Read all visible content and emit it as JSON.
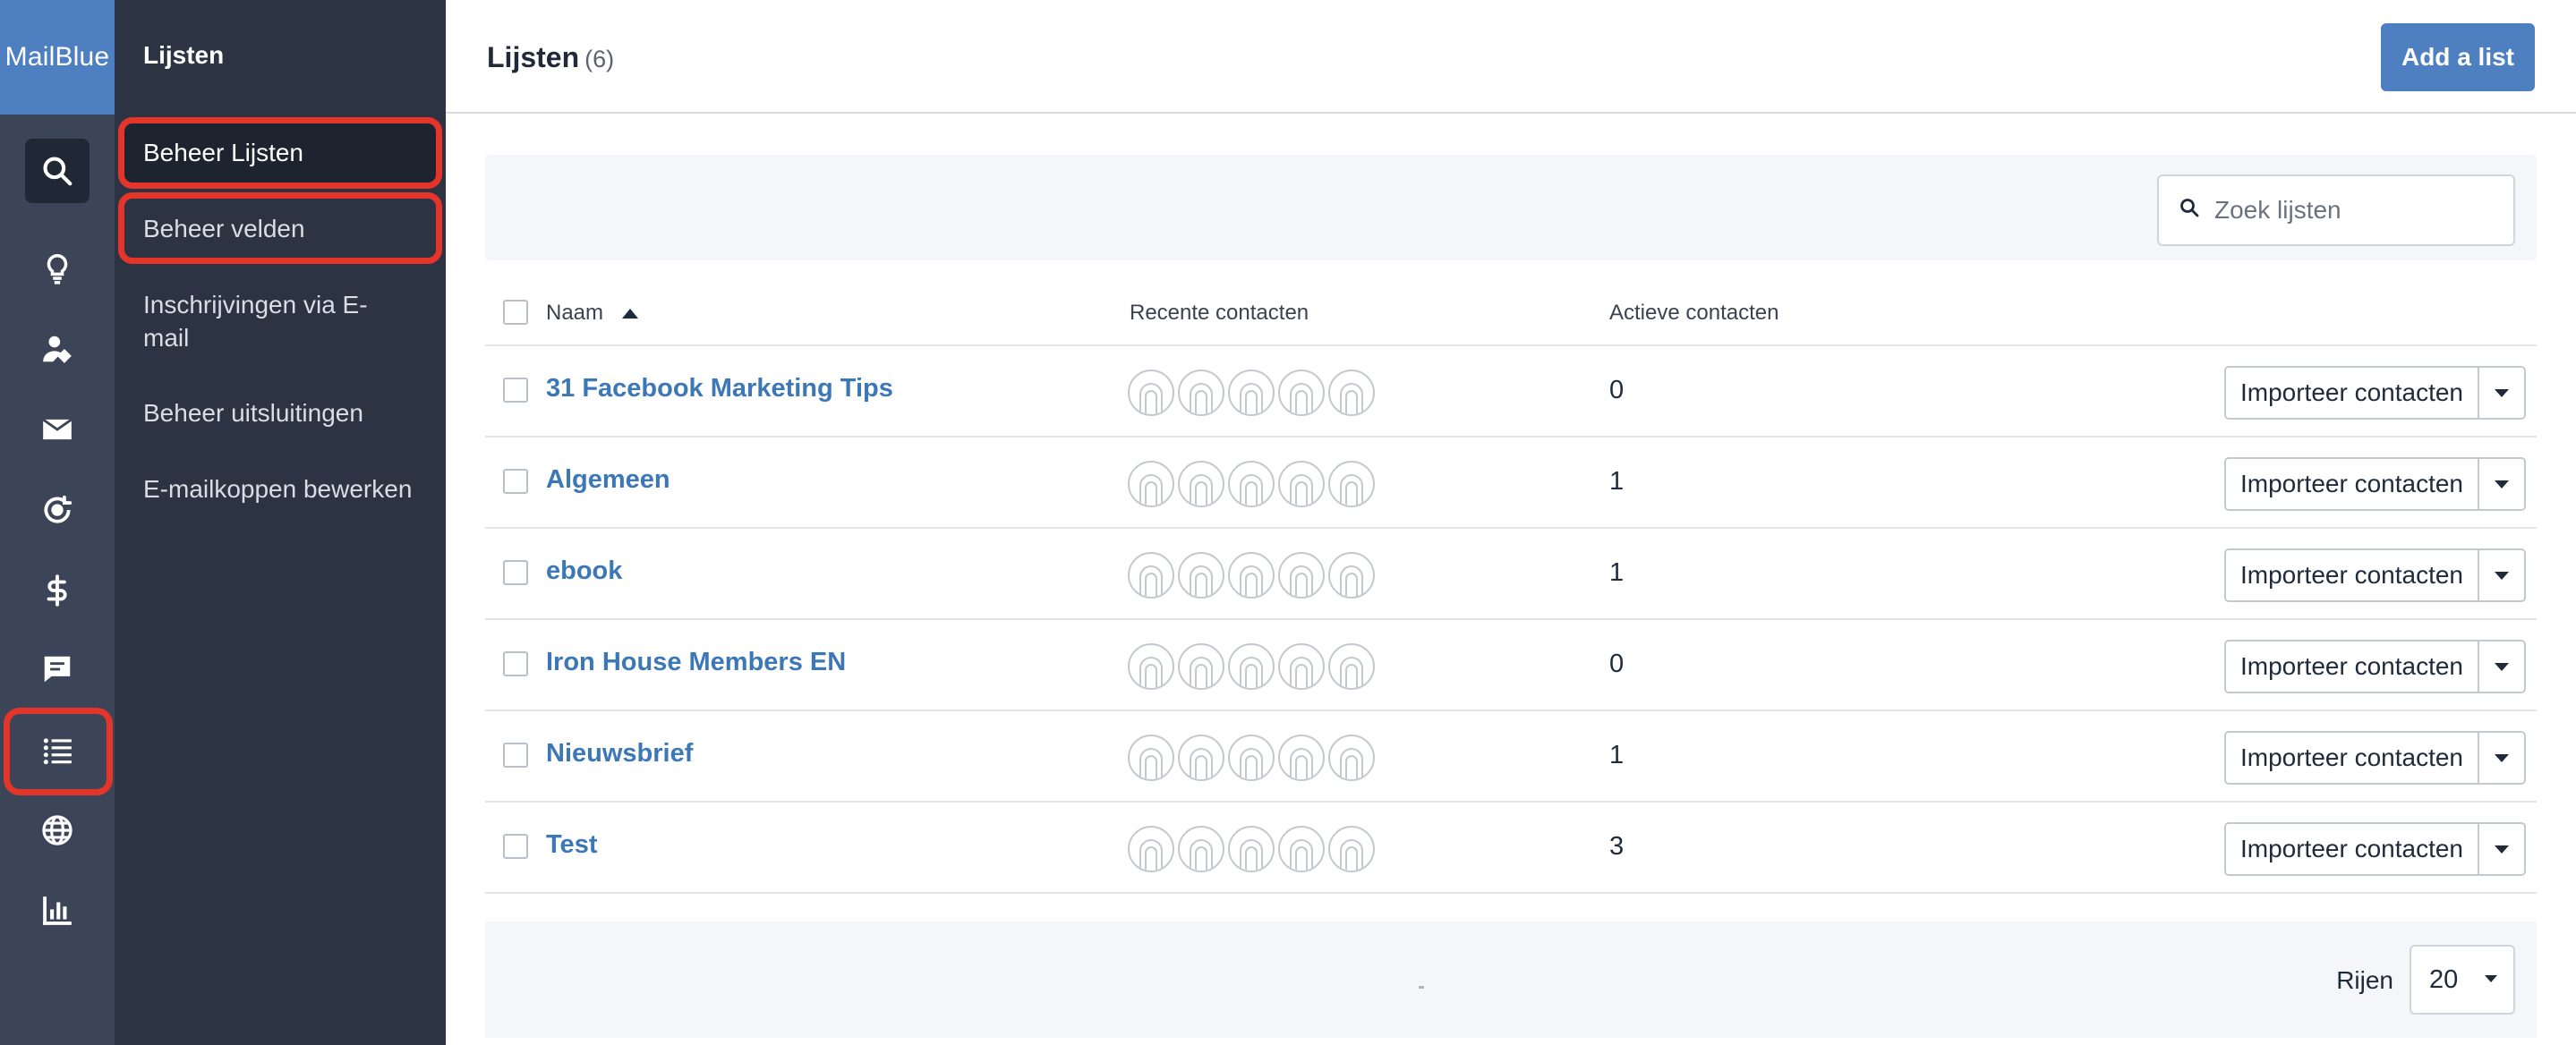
{
  "app": {
    "brand": "MailBlue"
  },
  "rail": {
    "icons": [
      "search-icon",
      "lightbulb-icon",
      "contacts-icon",
      "envelope-icon",
      "automation-icon",
      "dollar-icon",
      "chat-icon",
      "list-icon",
      "globe-icon",
      "bar-chart-icon"
    ],
    "active": "list-icon"
  },
  "subnav": {
    "title": "Lijsten",
    "items": [
      {
        "label": "Beheer Lijsten"
      },
      {
        "label": "Beheer velden"
      },
      {
        "label": "Inschrijvingen via E-mail"
      },
      {
        "label": "Beheer uitsluitingen"
      },
      {
        "label": "E-mailkoppen bewerken"
      }
    ]
  },
  "header": {
    "title": "Lijsten",
    "count": "(6)",
    "add_button": "Add a list"
  },
  "search": {
    "placeholder": "Zoek lijsten"
  },
  "table": {
    "columns": {
      "name": "Naam",
      "recent": "Recente contacten",
      "active": "Actieve contacten"
    },
    "import_label": "Importeer contacten",
    "rows": [
      {
        "name": "31 Facebook Marketing Tips",
        "active": "0"
      },
      {
        "name": "Algemeen",
        "active": "1"
      },
      {
        "name": "ebook",
        "active": "1"
      },
      {
        "name": "Iron House Members EN",
        "active": "0"
      },
      {
        "name": "Nieuwsbrief",
        "active": "1"
      },
      {
        "name": "Test",
        "active": "3"
      }
    ]
  },
  "footer": {
    "rows_label": "Rijen",
    "rows_value": "20"
  },
  "colors": {
    "brand": "#4e80c1",
    "highlight": "#e5352b",
    "link": "#3c77b8",
    "rail": "#3b4557",
    "subnav": "#2c3443"
  }
}
